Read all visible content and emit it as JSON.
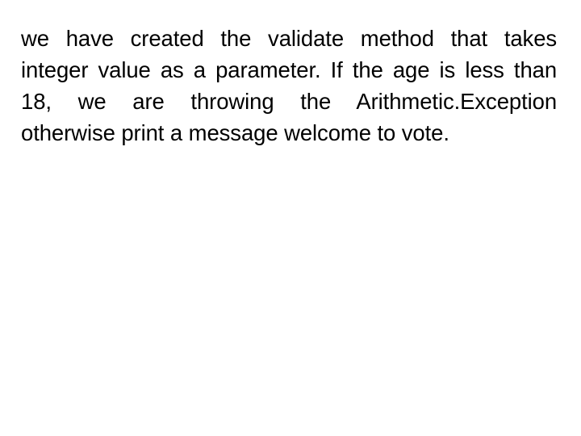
{
  "slide": {
    "background_color": "#ffffff",
    "text_color": "#000000",
    "body": {
      "full_text": "we have created the validate method that takes integer value as a parameter. If the age is less than 18, we are throwing the Arithmetic.Exception otherwise print a message welcome to vote.",
      "alignment": "justify",
      "lines": [
        "we have created the validate method that takes",
        "integer value as a parameter. If the age is less than",
        "18, we are throwing the Arithmetic.Exception",
        "otherwise print a message welcome to vote."
      ]
    }
  }
}
